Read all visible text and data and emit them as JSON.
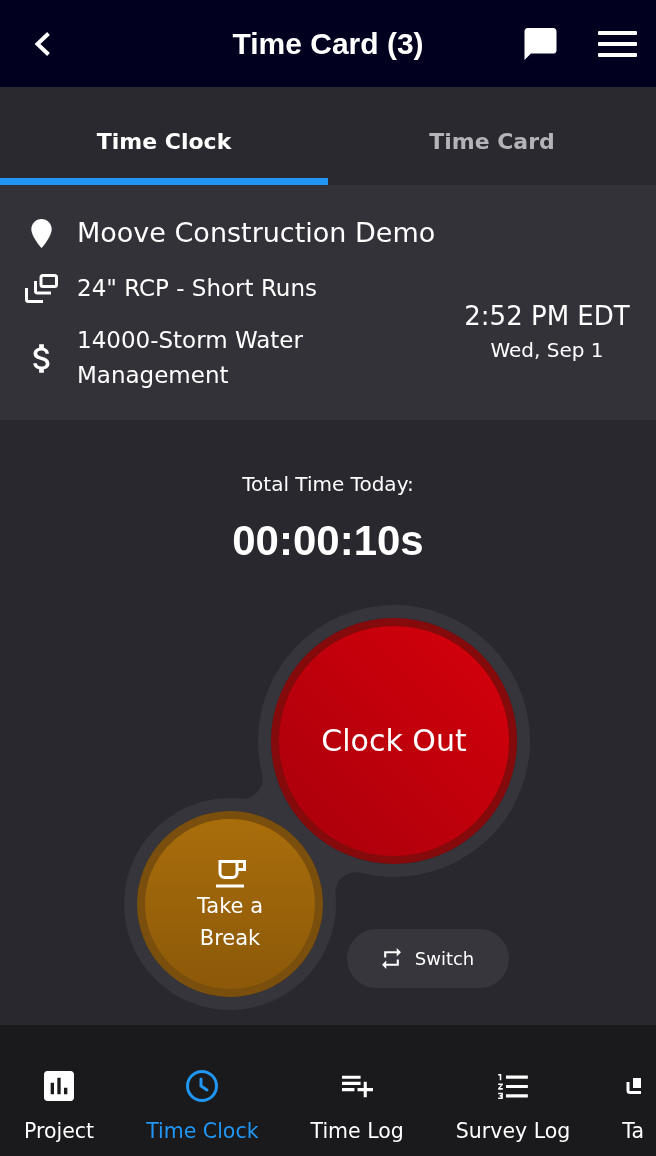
{
  "header": {
    "title": "Time Card (3)"
  },
  "tabs": [
    {
      "label": "Time Clock",
      "selected": true
    },
    {
      "label": "Time Card",
      "selected": false
    }
  ],
  "job": {
    "project": "Moove Construction Demo",
    "task": "24\" RCP - Short Runs",
    "cost_code": "14000-Storm Water Management",
    "time": "2:52 PM EDT",
    "date": "Wed, Sep 1"
  },
  "timer": {
    "label": "Total Time Today:",
    "value": "00:00:10s"
  },
  "actions": {
    "clock_out": "Clock Out",
    "take_break": "Take a Break",
    "switch": "Switch"
  },
  "bottom_nav": [
    {
      "label": "Project",
      "selected": false
    },
    {
      "label": "Time Clock",
      "selected": true
    },
    {
      "label": "Time Log",
      "selected": false
    },
    {
      "label": "Survey Log",
      "selected": false
    },
    {
      "label": "Ta",
      "selected": false
    }
  ]
}
